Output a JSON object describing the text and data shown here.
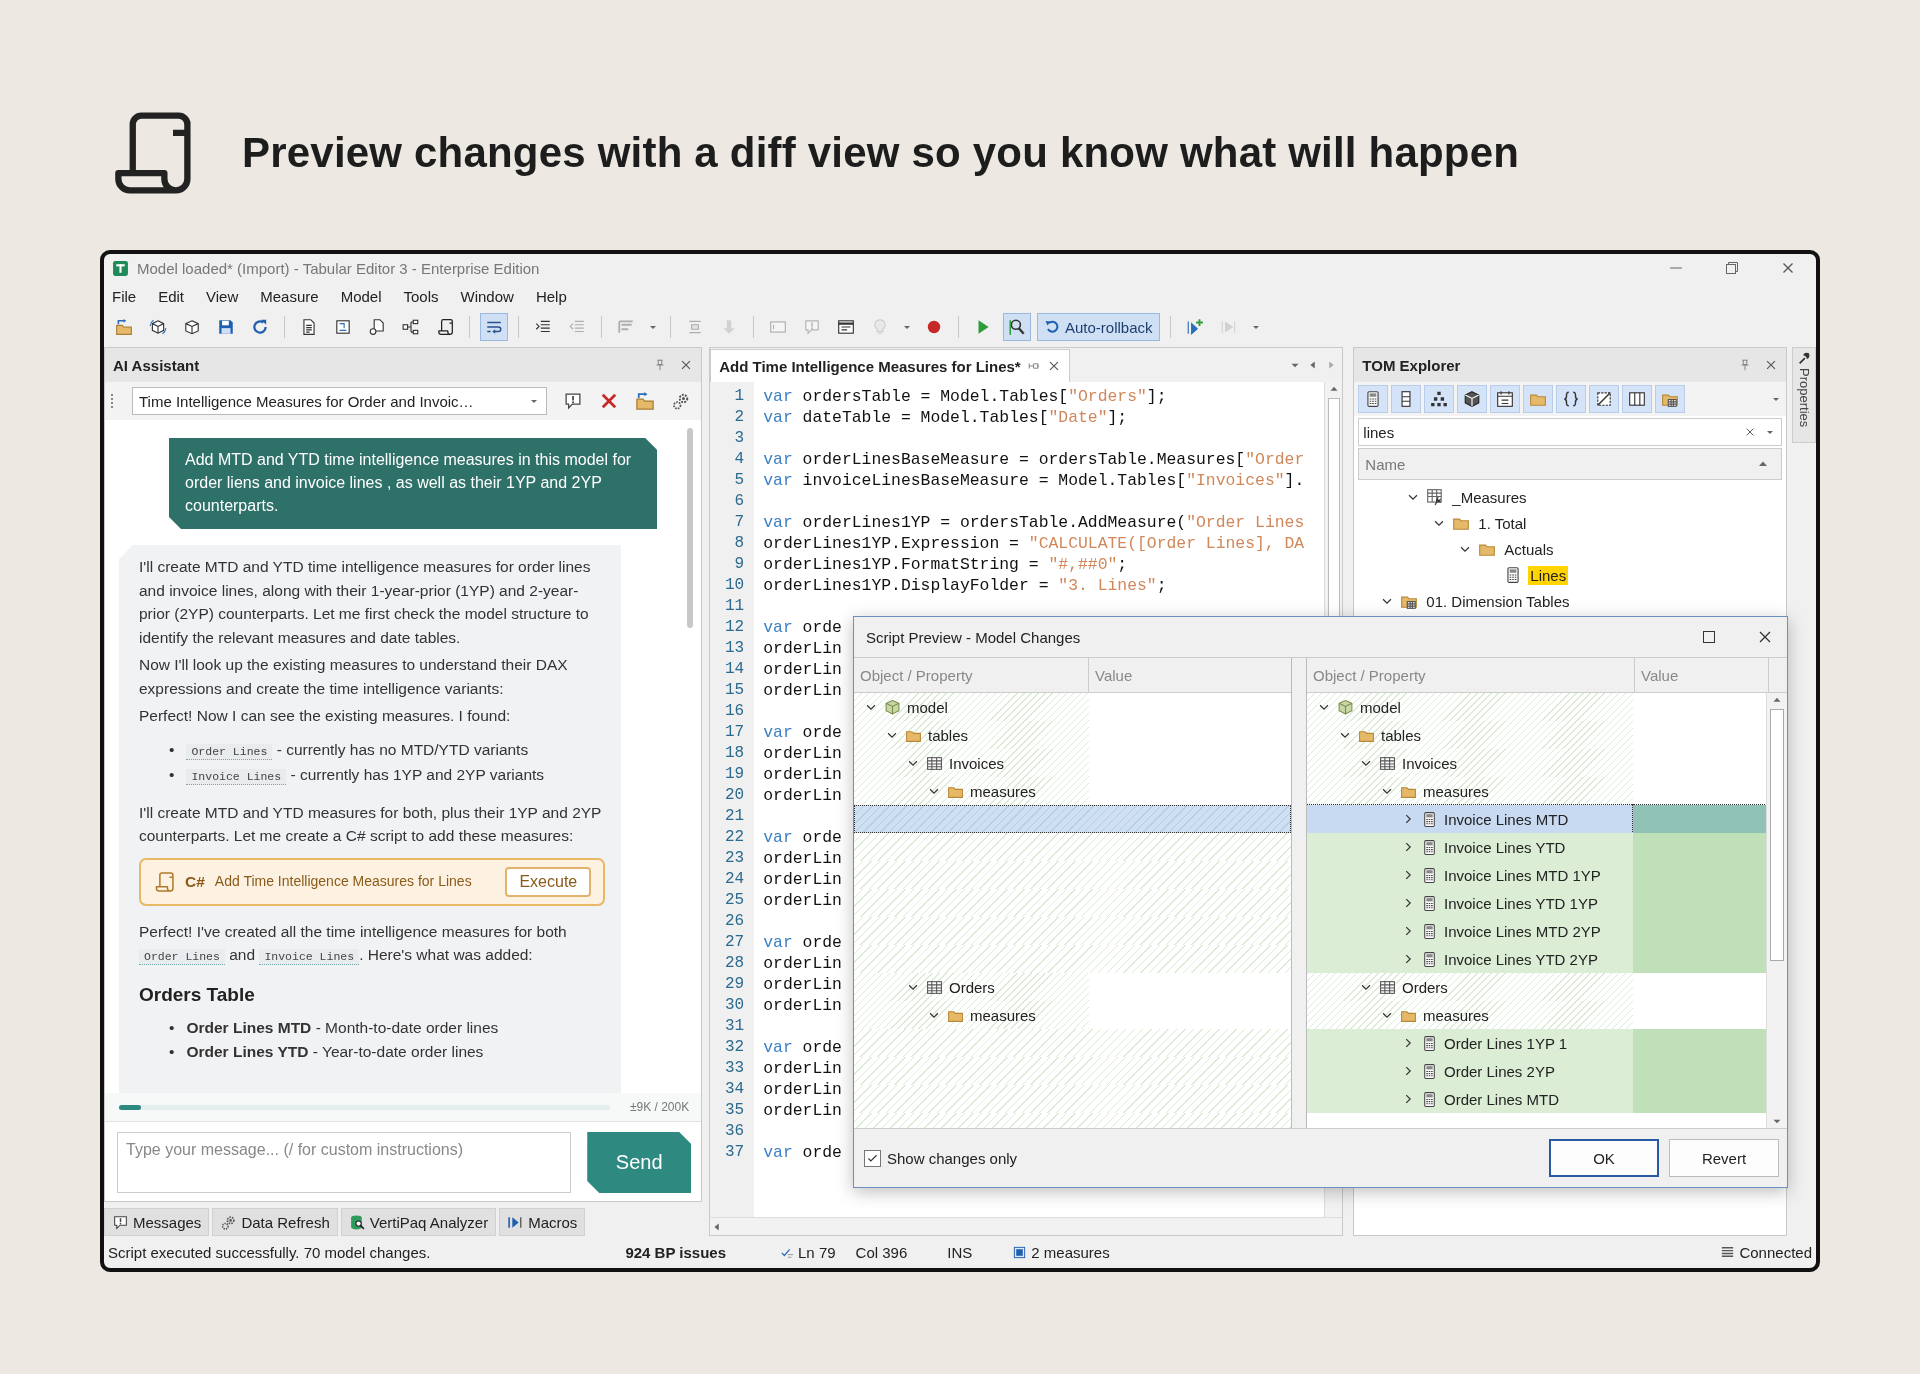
{
  "headline": {
    "text": "Preview changes with a diff view so you know what will happen"
  },
  "window": {
    "title": "Model loaded* (Import) - Tabular Editor 3 - Enterprise Edition"
  },
  "menu": [
    "File",
    "Edit",
    "View",
    "Measure",
    "Model",
    "Tools",
    "Window",
    "Help"
  ],
  "toolbar": [
    {
      "kind": "button",
      "selected": false,
      "disabled": false
    },
    {
      "kind": "button",
      "selected": false,
      "disabled": false
    },
    {
      "kind": "button",
      "selected": false,
      "disabled": false
    },
    {
      "kind": "button",
      "selected": false,
      "disabled": false
    },
    {
      "kind": "button",
      "selected": false,
      "disabled": false
    },
    {
      "kind": "separator"
    },
    {
      "kind": "button",
      "selected": false,
      "disabled": false
    },
    {
      "kind": "button",
      "selected": false,
      "disabled": false
    },
    {
      "kind": "button",
      "selected": false,
      "disabled": false
    },
    {
      "kind": "button",
      "selected": false,
      "disabled": false
    },
    {
      "kind": "button",
      "selected": false,
      "disabled": false
    },
    {
      "kind": "separator"
    },
    {
      "kind": "button",
      "selected": true,
      "disabled": false
    },
    {
      "kind": "separator"
    },
    {
      "kind": "button",
      "selected": false,
      "disabled": false
    },
    {
      "kind": "button",
      "selected": false,
      "disabled": true
    },
    {
      "kind": "separator"
    },
    {
      "kind": "button",
      "selected": false,
      "disabled": true
    },
    {
      "kind": "dropdown",
      "disabled": false
    },
    {
      "kind": "separator"
    },
    {
      "kind": "button",
      "selected": false,
      "disabled": true
    },
    {
      "kind": "button",
      "selected": false,
      "disabled": true
    },
    {
      "kind": "separator"
    },
    {
      "kind": "button",
      "selected": false,
      "disabled": true
    },
    {
      "kind": "button",
      "selected": false,
      "disabled": true
    },
    {
      "kind": "button",
      "selected": false,
      "disabled": false
    },
    {
      "kind": "button",
      "selected": false,
      "disabled": true
    },
    {
      "kind": "dropdown",
      "disabled": false
    },
    {
      "kind": "button",
      "selected": false,
      "disabled": false
    },
    {
      "kind": "separator"
    },
    {
      "kind": "button",
      "selected": false,
      "disabled": false
    },
    {
      "kind": "button",
      "selected": true,
      "disabled": false
    },
    {
      "kind": "label-button",
      "label": "Auto-rollback",
      "selected": true,
      "disabled": false
    },
    {
      "kind": "separator"
    },
    {
      "kind": "button",
      "selected": false,
      "disabled": false
    },
    {
      "kind": "button",
      "selected": false,
      "disabled": true
    },
    {
      "kind": "dropdown",
      "disabled": false
    }
  ],
  "ai_assistant": {
    "title": "AI Assistant",
    "conversation": "Time Intelligence Measures for Order and Invoic…",
    "user_message": "Add MTD and YTD time intelligence measures in this model for order liens and invoice lines , as well as their 1YP and 2YP counterparts.",
    "reply": [
      {
        "kind": "paragraph",
        "parts": [
          {
            "kind": "text",
            "text": "I'll create MTD and YTD time intelligence measures for order lines and invoice lines, along with their 1-year-prior (1YP) and 2-year-prior (2YP) counterparts. Let me first check the model structure to identify the relevant measures and date tables."
          }
        ]
      },
      {
        "kind": "paragraph",
        "parts": [
          {
            "kind": "text",
            "text": "Now I'll look up the existing measures to understand their DAX expressions and create the time intelligence variants:"
          }
        ]
      },
      {
        "kind": "paragraph",
        "parts": [
          {
            "kind": "text",
            "text": "Perfect! Now I can see the existing measures. I found:"
          }
        ]
      },
      {
        "kind": "bullets",
        "items": [
          {
            "marker": "•",
            "parts": [
              {
                "kind": "code",
                "text": "Order Lines"
              },
              {
                "kind": "text",
                "text": " - currently has no MTD/YTD variants"
              }
            ]
          },
          {
            "marker": "•",
            "parts": [
              {
                "kind": "code",
                "text": "Invoice Lines"
              },
              {
                "kind": "text",
                "text": " - currently has 1YP and 2YP variants"
              }
            ]
          }
        ]
      },
      {
        "kind": "paragraph",
        "parts": [
          {
            "kind": "text",
            "text": "I'll create MTD and YTD measures for both, plus their 1YP and 2YP counterparts. Let me create a C# script to add these measures:"
          }
        ]
      },
      {
        "kind": "script",
        "lang": "C#",
        "title": "Add Time Intelligence Measures for Lines",
        "action": "Execute"
      },
      {
        "kind": "paragraph",
        "parts": [
          {
            "kind": "text",
            "text": "Perfect! I've created all the time intelligence measures for both "
          },
          {
            "kind": "code",
            "text": "Order Lines"
          },
          {
            "kind": "text",
            "text": " and "
          },
          {
            "kind": "code",
            "text": "Invoice Lines"
          },
          {
            "kind": "text",
            "text": ". Here's what was added:"
          }
        ]
      },
      {
        "kind": "heading",
        "text": "Orders Table"
      },
      {
        "kind": "bullets",
        "items": [
          {
            "marker": "•",
            "parts": [
              {
                "kind": "text",
                "text": "**Order Lines MTD** - Month-to-date order lines"
              }
            ]
          },
          {
            "marker": "•",
            "parts": [
              {
                "kind": "text",
                "text": "**Order Lines YTD** - Year-to-date order lines"
              }
            ]
          }
        ]
      }
    ],
    "context": {
      "level": 0.045,
      "reading": "±9K / 200K"
    },
    "input": {
      "placeholder": "Type your message... (/ for custom instructions)"
    },
    "send": "Send"
  },
  "bottom_tabs": [
    "Messages",
    "Data Refresh",
    "VertiPaq Analyzer",
    "Macros"
  ],
  "editor": {
    "tab": "Add Time Intelligence Measures for Lines*",
    "lines": [
      {
        "n": "1",
        "parts": [
          {
            "kind": "keyword",
            "text": "var"
          },
          {
            "kind": "plain",
            "text": " ordersTable = Model.Tables["
          },
          {
            "kind": "string",
            "text": "\"Orders\""
          },
          {
            "kind": "plain",
            "text": "];"
          }
        ]
      },
      {
        "n": "2",
        "parts": [
          {
            "kind": "keyword",
            "text": "var"
          },
          {
            "kind": "plain",
            "text": " dateTable = Model.Tables["
          },
          {
            "kind": "string",
            "text": "\"Date\""
          },
          {
            "kind": "plain",
            "text": "];"
          }
        ]
      },
      {
        "n": "3"
      },
      {
        "n": "4",
        "parts": [
          {
            "kind": "keyword",
            "text": "var"
          },
          {
            "kind": "plain",
            "text": " orderLinesBaseMeasure = ordersTable.Measures["
          },
          {
            "kind": "string",
            "text": "\"Order"
          }
        ]
      },
      {
        "n": "5",
        "parts": [
          {
            "kind": "keyword",
            "text": "var"
          },
          {
            "kind": "plain",
            "text": " invoiceLinesBaseMeasure = Model.Tables["
          },
          {
            "kind": "string",
            "text": "\"Invoices\""
          },
          {
            "kind": "plain",
            "text": "]."
          }
        ]
      },
      {
        "n": "6"
      },
      {
        "n": "7",
        "parts": [
          {
            "kind": "keyword",
            "text": "var"
          },
          {
            "kind": "plain",
            "text": " orderLines1YP = ordersTable.AddMeasure("
          },
          {
            "kind": "string",
            "text": "\"Order Lines"
          }
        ]
      },
      {
        "n": "8",
        "parts": [
          {
            "kind": "plain",
            "text": "orderLines1YP.Expression = "
          },
          {
            "kind": "string",
            "text": "\"CALCULATE([Order Lines], DA"
          }
        ]
      },
      {
        "n": "9",
        "parts": [
          {
            "kind": "plain",
            "text": "orderLines1YP.FormatString = "
          },
          {
            "kind": "string",
            "text": "\"#,##0\""
          },
          {
            "kind": "plain",
            "text": ";"
          }
        ]
      },
      {
        "n": "10",
        "parts": [
          {
            "kind": "plain",
            "text": "orderLines1YP.DisplayFolder = "
          },
          {
            "kind": "string",
            "text": "\"3. Lines\""
          },
          {
            "kind": "plain",
            "text": ";"
          }
        ]
      },
      {
        "n": "11"
      },
      {
        "n": "12",
        "parts": [
          {
            "kind": "keyword",
            "text": "var"
          },
          {
            "kind": "plain",
            "text": " orde"
          }
        ]
      },
      {
        "n": "13",
        "parts": [
          {
            "kind": "plain",
            "text": "orderLin"
          }
        ]
      },
      {
        "n": "14",
        "parts": [
          {
            "kind": "plain",
            "text": "orderLin"
          }
        ]
      },
      {
        "n": "15",
        "parts": [
          {
            "kind": "plain",
            "text": "orderLin"
          }
        ]
      },
      {
        "n": "16"
      },
      {
        "n": "17",
        "parts": [
          {
            "kind": "keyword",
            "text": "var"
          },
          {
            "kind": "plain",
            "text": " orde"
          }
        ]
      },
      {
        "n": "18",
        "parts": [
          {
            "kind": "plain",
            "text": "orderLin"
          }
        ]
      },
      {
        "n": "19",
        "parts": [
          {
            "kind": "plain",
            "text": "orderLin"
          }
        ]
      },
      {
        "n": "20",
        "parts": [
          {
            "kind": "plain",
            "text": "orderLin"
          }
        ]
      },
      {
        "n": "21"
      },
      {
        "n": "22",
        "parts": [
          {
            "kind": "keyword",
            "text": "var"
          },
          {
            "kind": "plain",
            "text": " orde"
          }
        ]
      },
      {
        "n": "23",
        "parts": [
          {
            "kind": "plain",
            "text": "orderLin"
          }
        ]
      },
      {
        "n": "24",
        "parts": [
          {
            "kind": "plain",
            "text": "orderLin"
          }
        ]
      },
      {
        "n": "25",
        "parts": [
          {
            "kind": "plain",
            "text": "orderLin"
          }
        ]
      },
      {
        "n": "26"
      },
      {
        "n": "27",
        "parts": [
          {
            "kind": "keyword",
            "text": "var"
          },
          {
            "kind": "plain",
            "text": " orde"
          }
        ]
      },
      {
        "n": "28",
        "parts": [
          {
            "kind": "plain",
            "text": "orderLin"
          }
        ]
      },
      {
        "n": "29",
        "parts": [
          {
            "kind": "plain",
            "text": "orderLin"
          }
        ]
      },
      {
        "n": "30",
        "parts": [
          {
            "kind": "plain",
            "text": "orderLin"
          }
        ]
      },
      {
        "n": "31"
      },
      {
        "n": "32",
        "parts": [
          {
            "kind": "keyword",
            "text": "var"
          },
          {
            "kind": "plain",
            "text": " orde"
          }
        ]
      },
      {
        "n": "33",
        "parts": [
          {
            "kind": "plain",
            "text": "orderLin"
          }
        ]
      },
      {
        "n": "34",
        "parts": [
          {
            "kind": "plain",
            "text": "orderLin"
          }
        ]
      },
      {
        "n": "35",
        "parts": [
          {
            "kind": "plain",
            "text": "orderLin"
          }
        ]
      },
      {
        "n": "36"
      },
      {
        "n": "37",
        "parts": [
          {
            "kind": "keyword",
            "text": "var"
          },
          {
            "kind": "plain",
            "text": " orde"
          }
        ]
      }
    ]
  },
  "tom_explorer": {
    "title": "TOM Explorer",
    "filters": [
      {
        "selected": true
      },
      {
        "selected": true
      },
      {
        "selected": true
      },
      {
        "selected": true
      },
      {
        "selected": true
      },
      {
        "selected": true
      },
      {
        "selected": true
      },
      {
        "selected": true
      },
      {
        "selected": true
      },
      {
        "selected": true
      }
    ],
    "search": {
      "value": "lines"
    },
    "column": "Name",
    "tree": [
      {
        "children": [
          {
            "name": "_Measures",
            "kind": "measure-table",
            "expanded": true,
            "highlighted": false,
            "children": [
              {
                "name": "1. Total",
                "kind": "folder",
                "expanded": true,
                "highlighted": false,
                "children": [
                  {
                    "name": "Actuals",
                    "kind": "folder",
                    "expanded": true,
                    "highlighted": false,
                    "children": [
                      {
                        "name": "Lines",
                        "kind": "measure",
                        "highlighted": true
                      }
                    ]
                  }
                ]
              }
            ]
          }
        ]
      },
      {
        "name": "01. Dimension Tables",
        "kind": "table-group",
        "expanded": true,
        "highlighted": false
      }
    ]
  },
  "properties_tab": "Properties",
  "status_bar": {
    "message": "Script executed successfully. 70 model changes.",
    "issues": "924 BP issues",
    "line": "Ln 79",
    "column": "Col 396",
    "mode": "INS",
    "selection": "2 measures",
    "connection": "Connected"
  },
  "dialog": {
    "title": "Script Preview - Model Changes",
    "left_columns": [
      "Object / Property",
      "Value"
    ],
    "right_columns": [
      "Object / Property",
      "Value"
    ],
    "before": [
      {
        "name": "model",
        "kind": "model",
        "expanded": true,
        "children": [
          {
            "name": "tables",
            "kind": "folder",
            "expanded": true,
            "children": [
              {
                "name": "Invoices",
                "kind": "table",
                "expanded": true,
                "children": [
                  {
                    "name": "measures",
                    "kind": "folder",
                    "expanded": true,
                    "children": [
                      {
                        "kind": "placeholder",
                        "selected": true
                      },
                      {
                        "kind": "placeholder",
                        "selected": false
                      },
                      {
                        "kind": "placeholder",
                        "selected": false
                      },
                      {
                        "kind": "placeholder",
                        "selected": false
                      },
                      {
                        "kind": "placeholder",
                        "selected": false
                      },
                      {
                        "kind": "placeholder",
                        "selected": false
                      }
                    ]
                  }
                ]
              },
              {
                "name": "Orders",
                "kind": "table",
                "expanded": true,
                "children": [
                  {
                    "name": "measures",
                    "kind": "folder",
                    "expanded": true,
                    "children": [
                      {
                        "kind": "placeholder",
                        "selected": false
                      },
                      {
                        "kind": "placeholder",
                        "selected": false
                      },
                      {
                        "kind": "placeholder",
                        "selected": false
                      }
                    ]
                  }
                ]
              }
            ]
          }
        ]
      }
    ],
    "after": [
      {
        "name": "model",
        "kind": "model",
        "added": false,
        "expanded": true,
        "selected": false,
        "children": [
          {
            "name": "tables",
            "kind": "folder",
            "added": false,
            "expanded": true,
            "selected": false,
            "children": [
              {
                "name": "Invoices",
                "kind": "table",
                "added": false,
                "expanded": true,
                "selected": false,
                "children": [
                  {
                    "name": "measures",
                    "kind": "folder",
                    "added": false,
                    "expanded": true,
                    "selected": false,
                    "children": [
                      {
                        "name": "Invoice Lines MTD",
                        "kind": "measure",
                        "added": true,
                        "expanded": false,
                        "selected": true
                      },
                      {
                        "name": "Invoice Lines YTD",
                        "kind": "measure",
                        "added": true,
                        "expanded": false,
                        "selected": false
                      },
                      {
                        "name": "Invoice Lines MTD 1YP",
                        "kind": "measure",
                        "added": true,
                        "expanded": false,
                        "selected": false
                      },
                      {
                        "name": "Invoice Lines YTD 1YP",
                        "kind": "measure",
                        "added": true,
                        "expanded": false,
                        "selected": false
                      },
                      {
                        "name": "Invoice Lines MTD 2YP",
                        "kind": "measure",
                        "added": true,
                        "expanded": false,
                        "selected": false
                      },
                      {
                        "name": "Invoice Lines YTD 2YP",
                        "kind": "measure",
                        "added": true,
                        "expanded": false,
                        "selected": false
                      }
                    ]
                  }
                ]
              },
              {
                "name": "Orders",
                "kind": "table",
                "added": false,
                "expanded": true,
                "selected": false,
                "children": [
                  {
                    "name": "measures",
                    "kind": "folder",
                    "added": false,
                    "expanded": true,
                    "selected": false,
                    "children": [
                      {
                        "name": "Order Lines 1YP 1",
                        "kind": "measure",
                        "added": true,
                        "expanded": false,
                        "selected": false
                      },
                      {
                        "name": "Order Lines 2YP",
                        "kind": "measure",
                        "added": true,
                        "expanded": false,
                        "selected": false
                      },
                      {
                        "name": "Order Lines MTD",
                        "kind": "measure",
                        "added": true,
                        "expanded": false,
                        "selected": false
                      }
                    ]
                  }
                ]
              }
            ]
          }
        ]
      }
    ],
    "show_changes_only": {
      "label": "Show changes only",
      "checked": true
    },
    "buttons": [
      {
        "label": "OK",
        "default": true
      },
      {
        "label": "Revert",
        "default": false
      }
    ]
  }
}
